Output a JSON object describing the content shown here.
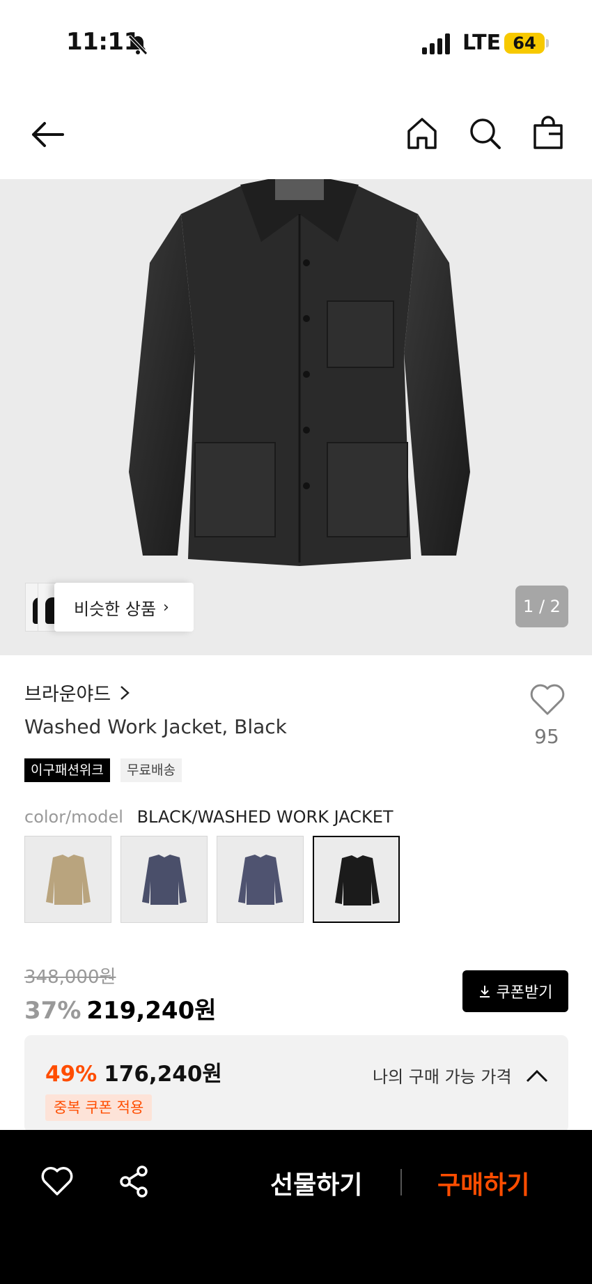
{
  "status_bar": {
    "time": "11:11",
    "network": "LTE",
    "battery": "64",
    "icons": [
      "bell-mute-icon",
      "signal-icon"
    ]
  },
  "nav": {
    "icons": [
      "back-arrow-icon",
      "home-icon",
      "search-icon",
      "shopping-bag-icon"
    ]
  },
  "gallery": {
    "similar_label": "비슷한 상품",
    "page_indicator": "1 / 2",
    "current_page": 1,
    "total_pages": 2
  },
  "product": {
    "brand": "브라운야드",
    "title": "Washed Work Jacket, Black",
    "like_count": "95",
    "tags": [
      "이구패션위크",
      "무료배송"
    ],
    "color_label": "color/model",
    "color_value": "BLACK/WASHED WORK JACKET",
    "swatches": [
      {
        "name": "beige",
        "color": "#b9a47e"
      },
      {
        "name": "navy",
        "color": "#4a4f6a"
      },
      {
        "name": "indigo",
        "color": "#4f5370"
      },
      {
        "name": "black",
        "color": "#1b1b1b",
        "selected": true
      }
    ]
  },
  "price": {
    "original": "348,000원",
    "discount": "37%",
    "sale": "219,240원",
    "coupon_button": "쿠폰받기",
    "best_discount": "49%",
    "best_price": "176,240원",
    "coupon_badge": "중복 쿠폰 적용",
    "my_price_label": "나의 구매 가능 가격"
  },
  "bottom_bar": {
    "gift_label": "선물하기",
    "buy_label": "구매하기"
  },
  "colors": {
    "accent": "#ff4d00",
    "battery": "#f7c900",
    "hero_bg": "#ebebeb"
  }
}
